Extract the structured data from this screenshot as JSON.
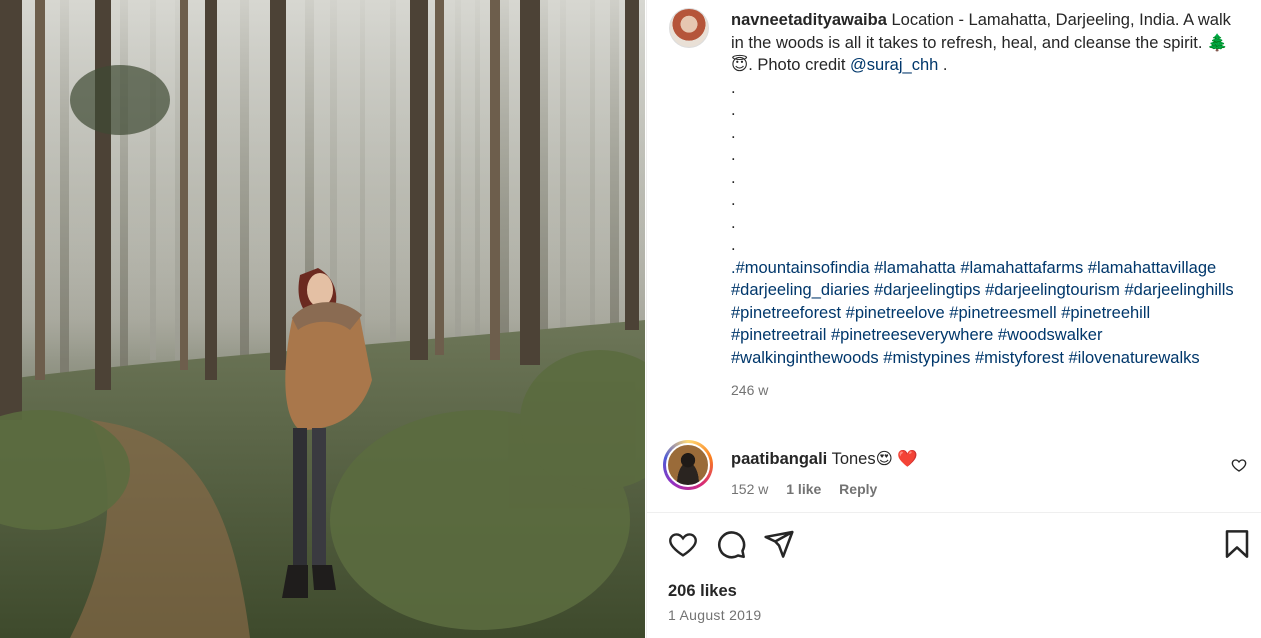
{
  "post": {
    "username": "navneetadityawaiba",
    "caption_text": "Location - Lamahatta, Darjeeling, India. A walk in the woods is all it takes to refresh, heal, and cleanse the spirit. 🌲😇. Photo credit",
    "mention": "@suraj_chh",
    "after_mention": ".",
    "dots": [
      ".",
      ".",
      ".",
      ".",
      ".",
      ".",
      ".",
      "."
    ],
    "hashtags": ".#mountainsofindia #lamahatta #lamahattafarms #lamahattavillage #darjeeling_diaries #darjeelingtips #darjeelingtourism #darjeelinghills #pinetreeforest #pinetreelove #pinetreesmell #pinetreehill #pinetreetrail #pinetreeseverywhere #woodswalker #walkinginthewoods #mistypines #mistyforest #ilovenaturewalks",
    "time_ago": "246 w"
  },
  "comment": {
    "username": "paatibangali",
    "text": "Tones😍 ❤️",
    "time_ago": "152 w",
    "likes": "1 like",
    "reply_label": "Reply"
  },
  "footer": {
    "likes": "206 likes",
    "date": "1 August 2019"
  },
  "icons": {
    "like": "heart-icon",
    "comment": "comment-icon",
    "share": "share-icon",
    "save": "bookmark-icon",
    "comment_like": "heart-icon"
  }
}
